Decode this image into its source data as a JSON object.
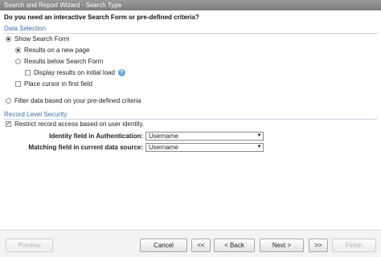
{
  "window": {
    "title": "Search and Report Wizard - Search Type"
  },
  "question": "Do you need an interactive Search Form or pre-defined criteria?",
  "data_selection": {
    "title": "Data Selection",
    "show_search_form": "Show Search Form",
    "results_new_page": "Results on a new page",
    "results_below": "Results below Search Form",
    "display_initial": "Display results on initial load",
    "help_glyph": "?",
    "cursor_first": "Place cursor in first field",
    "filter_predefined": "Filter data based on your pre-defined criteria",
    "selected_mode": "show_search_form",
    "selected_results": "results_new_page"
  },
  "record_security": {
    "title": "Record Level Security",
    "restrict_label": "Restrict record access based on user identity.",
    "restrict_checked": true,
    "check_glyph": "✓",
    "identity_label": "Identity field in Authentication:",
    "identity_value": "Username",
    "matching_label": "Matching field in current data source:",
    "matching_value": "Username",
    "caret": "▼"
  },
  "buttons": {
    "preview": "Preview",
    "cancel": "Cancel",
    "first": "<<",
    "back": "< Back",
    "next": "Next >",
    "last": ">>",
    "finish": "Finish"
  },
  "colors": {
    "title_bar": "#8a8a8a",
    "section_title": "#3a6fae",
    "help_icon": "#6aa6d8"
  }
}
